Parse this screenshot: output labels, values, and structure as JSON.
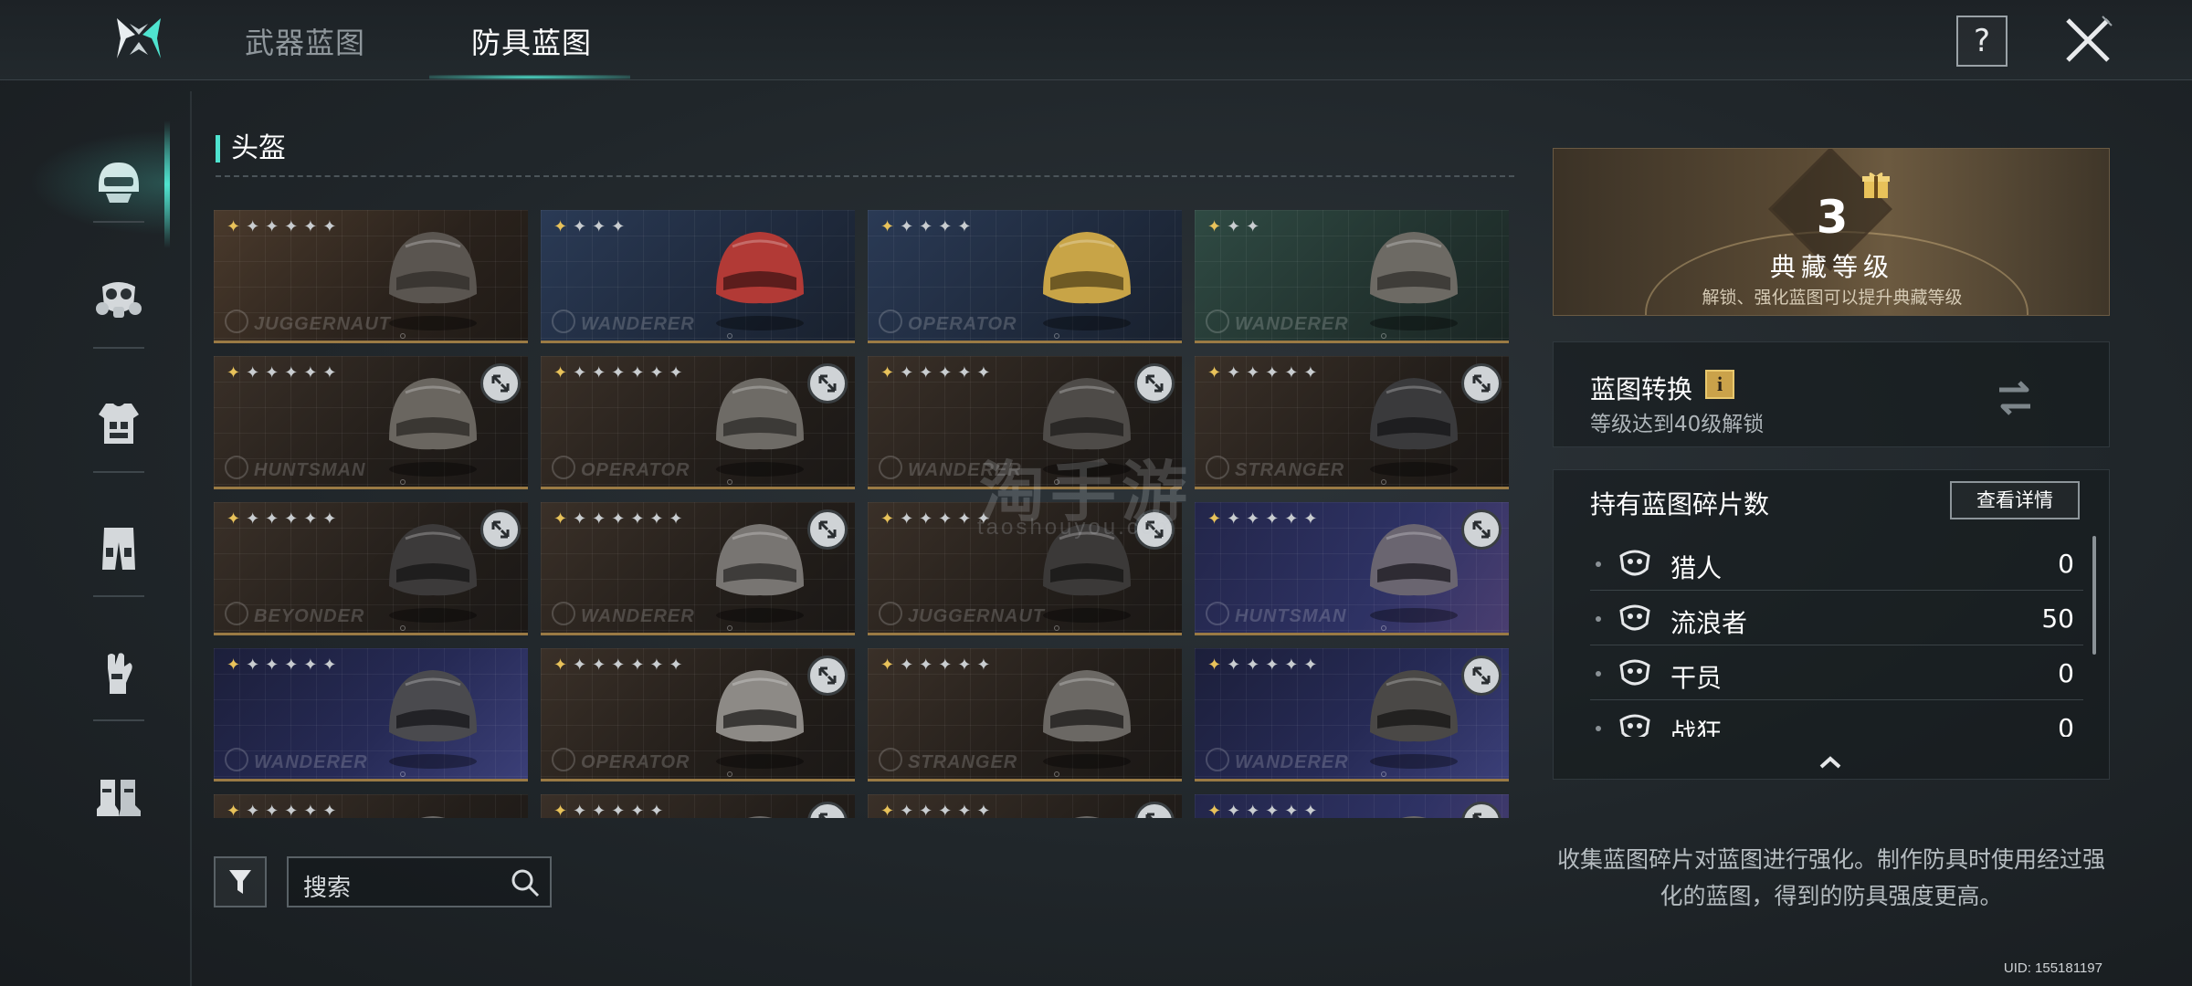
{
  "tabs": [
    {
      "label": "武器蓝图",
      "active": false
    },
    {
      "label": "防具蓝图",
      "active": true
    }
  ],
  "header": {
    "help_label": "?",
    "icons": {
      "logo": "game-logo-icon",
      "close": "close-icon",
      "help": "help-icon"
    }
  },
  "sidebar": {
    "items": [
      {
        "name": "helmet",
        "icon": "helmet-icon",
        "active": true
      },
      {
        "name": "mask",
        "icon": "gas-mask-icon",
        "active": false
      },
      {
        "name": "armor",
        "icon": "body-armor-icon",
        "active": false
      },
      {
        "name": "pants",
        "icon": "pants-icon",
        "active": false
      },
      {
        "name": "gloves",
        "icon": "gloves-icon",
        "active": false
      },
      {
        "name": "boots",
        "icon": "boots-icon",
        "active": false
      }
    ]
  },
  "section": {
    "title": "头盔"
  },
  "cards": [
    {
      "brand": "JUGGERNAUT",
      "stars_gold": 1,
      "stars_total": 6,
      "bg": "brown",
      "helmet": "dark-combat",
      "locked": false
    },
    {
      "brand": "WANDERER",
      "stars_gold": 1,
      "stars_total": 4,
      "bg": "blue",
      "helmet": "red-striped",
      "locked": false
    },
    {
      "brand": "OPERATOR",
      "stars_gold": 1,
      "stars_total": 5,
      "bg": "blue",
      "helmet": "yellow-camo",
      "locked": false
    },
    {
      "brand": "WANDERER",
      "stars_gold": 1,
      "stars_total": 3,
      "bg": "green",
      "helmet": "cap",
      "locked": false
    },
    {
      "brand": "HUNTSMAN",
      "stars_gold": 1,
      "stars_total": 6,
      "bg": "dark",
      "helmet": "winter-hat",
      "locked": true
    },
    {
      "brand": "OPERATOR",
      "stars_gold": 1,
      "stars_total": 7,
      "bg": "dark",
      "helmet": "bucket-hat",
      "locked": true
    },
    {
      "brand": "WANDERER",
      "stars_gold": 1,
      "stars_total": 6,
      "bg": "dark",
      "helmet": "fedora",
      "locked": true
    },
    {
      "brand": "STRANGER",
      "stars_gold": 1,
      "stars_total": 6,
      "bg": "dark",
      "helmet": "cage-helmet",
      "locked": true
    },
    {
      "brand": "BEYONDER",
      "stars_gold": 1,
      "stars_total": 6,
      "bg": "dark",
      "helmet": "tactical",
      "locked": true
    },
    {
      "brand": "WANDERER",
      "stars_gold": 1,
      "stars_total": 7,
      "bg": "dark",
      "helmet": "hood",
      "locked": true
    },
    {
      "brand": "JUGGERNAUT",
      "stars_gold": 1,
      "stars_total": 6,
      "bg": "dark",
      "helmet": "gasmask-helmet",
      "locked": true
    },
    {
      "brand": "HUNTSMAN",
      "stars_gold": 1,
      "stars_total": 6,
      "bg": "violet",
      "helmet": "cage-mask",
      "locked": true
    },
    {
      "brand": "WANDERER",
      "stars_gold": 1,
      "stars_total": 6,
      "bg": "purple",
      "helmet": "respirator",
      "locked": false
    },
    {
      "brand": "OPERATOR",
      "stars_gold": 1,
      "stars_total": 7,
      "bg": "dark",
      "helmet": "skull-mask",
      "locked": true
    },
    {
      "brand": "STRANGER",
      "stars_gold": 1,
      "stars_total": 6,
      "bg": "dark",
      "helmet": "hooded-mask",
      "locked": false
    },
    {
      "brand": "WANDERER",
      "stars_gold": 1,
      "stars_total": 6,
      "bg": "purple",
      "helmet": "goggles-cap",
      "locked": true
    },
    {
      "brand": "",
      "stars_gold": 1,
      "stars_total": 6,
      "bg": "dark",
      "helmet": "partial",
      "locked": false
    },
    {
      "brand": "",
      "stars_gold": 1,
      "stars_total": 6,
      "bg": "dark",
      "helmet": "partial",
      "locked": true
    },
    {
      "brand": "",
      "stars_gold": 1,
      "stars_total": 6,
      "bg": "dark",
      "helmet": "partial",
      "locked": true
    },
    {
      "brand": "",
      "stars_gold": 1,
      "stars_total": 6,
      "bg": "violet",
      "helmet": "partial",
      "locked": true
    }
  ],
  "search": {
    "placeholder": "搜索"
  },
  "collection": {
    "level": "3",
    "title": "典藏等级",
    "subtitle": "解锁、强化蓝图可以提升典藏等级"
  },
  "convert": {
    "title": "蓝图转换",
    "info_label": "i",
    "subtitle": "等级达到40级解锁"
  },
  "fragments": {
    "title": "持有蓝图碎片数",
    "detail_label": "查看详情",
    "rows": [
      {
        "name": "猎人",
        "count": "0",
        "icon": "hunter-emblem-icon"
      },
      {
        "name": "流浪者",
        "count": "50",
        "icon": "wanderer-emblem-icon"
      },
      {
        "name": "干员",
        "count": "0",
        "icon": "operator-emblem-icon"
      },
      {
        "name": "战狂",
        "count": "0",
        "icon": "berserker-emblem-icon"
      }
    ]
  },
  "description": "收集蓝图碎片对蓝图进行强化。制作防具时使用经过强化的蓝图，得到的防具强度更高。",
  "uid": "UID: 155181197",
  "watermark": {
    "main": "淘手游",
    "sub": "taoshouyou.com"
  },
  "colors": {
    "accent": "#4fe3cf",
    "gold": "#e8c25a",
    "card_border": "#9a7a44",
    "badge": "#caa24a"
  }
}
